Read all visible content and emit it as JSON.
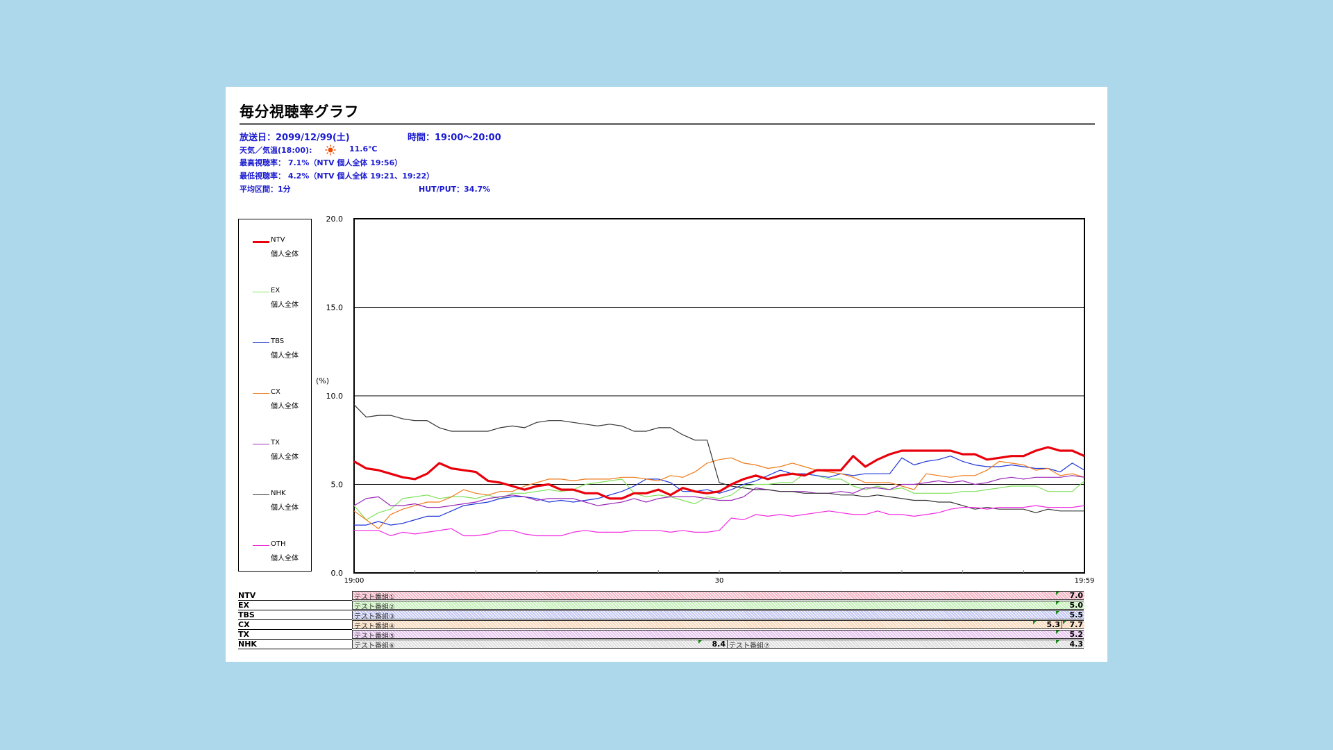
{
  "title": "毎分視聴率グラフ",
  "info": {
    "broadcast_date": "放送日：2099/12/99(土)",
    "time": "時間：19:00～20:00",
    "weather_label": "天気／気温(18:00):",
    "weather_icon": "sun-icon",
    "temperature": "11.6℃",
    "max_rating": "最高視聴率：  7.1%（NTV 個人全体 19:56）",
    "min_rating": "最低視聴率：  4.2%（NTV 個人全体 19:21、19:22）",
    "interval": "平均区間：1分",
    "hut_put": "HUT/PUT：34.7%"
  },
  "legend": [
    {
      "name": "NTV",
      "sub": "個人全体",
      "color": "#e8000b",
      "width": 3
    },
    {
      "name": "EX",
      "sub": "個人全体",
      "color": "#7fe05a",
      "width": 1
    },
    {
      "name": "TBS",
      "sub": "個人全体",
      "color": "#1f35d8",
      "width": 1
    },
    {
      "name": "CX",
      "sub": "個人全体",
      "color": "#f07a1a",
      "width": 1
    },
    {
      "name": "TX",
      "sub": "個人全体",
      "color": "#9a28b8",
      "width": 1
    },
    {
      "name": "NHK",
      "sub": "個人全体",
      "color": "#333333",
      "width": 1
    },
    {
      "name": "OTH",
      "sub": "個人全体",
      "color": "#f02ae0",
      "width": 1
    }
  ],
  "chart_data": {
    "type": "line",
    "ylabel": "(%)",
    "ylim": [
      0,
      20
    ],
    "yticks": [
      "0.0",
      "5.0",
      "10.0",
      "15.0",
      "20.0"
    ],
    "xticks": [
      "19:00",
      "30",
      "19:59"
    ],
    "x_minutes": [
      0,
      59
    ],
    "grid": true,
    "series": [
      {
        "name": "NTV",
        "values": [
          6.3,
          5.9,
          5.8,
          5.6,
          5.4,
          5.3,
          5.6,
          6.2,
          5.9,
          5.8,
          5.7,
          5.2,
          5.1,
          4.9,
          4.7,
          4.9,
          5.0,
          4.7,
          4.7,
          4.5,
          4.5,
          4.2,
          4.2,
          4.5,
          4.5,
          4.7,
          4.4,
          4.8,
          4.6,
          4.5,
          4.6,
          5.0,
          5.3,
          5.5,
          5.3,
          5.5,
          5.6,
          5.5,
          5.8,
          5.8,
          5.8,
          6.6,
          6.0,
          6.4,
          6.7,
          6.9,
          6.9,
          6.9,
          6.9,
          6.9,
          6.7,
          6.7,
          6.4,
          6.5,
          6.6,
          6.6,
          6.9,
          7.1,
          6.9,
          6.9,
          6.6
        ]
      },
      {
        "name": "EX",
        "values": [
          3.8,
          3.0,
          3.4,
          3.6,
          4.2,
          4.3,
          4.4,
          4.2,
          4.3,
          4.3,
          4.2,
          4.4,
          4.2,
          4.5,
          4.5,
          4.6,
          4.7,
          4.6,
          4.7,
          5.0,
          5.1,
          5.2,
          5.3,
          4.5,
          4.3,
          4.4,
          4.3,
          4.1,
          3.9,
          4.3,
          4.2,
          4.4,
          4.9,
          5.0,
          5.0,
          5.1,
          5.1,
          5.6,
          5.5,
          5.3,
          5.3,
          4.9,
          4.7,
          4.9,
          4.7,
          4.8,
          4.5,
          4.5,
          4.5,
          4.5,
          4.6,
          4.6,
          4.7,
          4.8,
          4.9,
          4.9,
          4.9,
          4.6,
          4.6,
          4.6,
          5.2
        ]
      },
      {
        "name": "TBS",
        "values": [
          2.7,
          2.7,
          2.9,
          2.7,
          2.8,
          3.0,
          3.2,
          3.2,
          3.5,
          3.8,
          3.9,
          4.0,
          4.2,
          4.3,
          4.3,
          4.2,
          4.0,
          4.1,
          4.0,
          4.1,
          4.2,
          4.4,
          4.6,
          4.9,
          5.3,
          5.3,
          5.1,
          4.6,
          4.6,
          4.7,
          4.5,
          4.7,
          5.0,
          5.2,
          5.5,
          5.8,
          5.6,
          5.6,
          5.5,
          5.4,
          5.6,
          5.5,
          5.6,
          5.6,
          5.6,
          6.5,
          6.1,
          6.3,
          6.4,
          6.6,
          6.3,
          6.1,
          6.0,
          6.0,
          6.1,
          6.0,
          5.9,
          5.9,
          5.7,
          6.2,
          5.8
        ]
      },
      {
        "name": "CX",
        "values": [
          3.5,
          3.0,
          2.5,
          3.3,
          3.6,
          3.8,
          4.0,
          4.0,
          4.3,
          4.7,
          4.5,
          4.4,
          4.6,
          4.6,
          4.9,
          5.1,
          5.3,
          5.3,
          5.2,
          5.3,
          5.3,
          5.3,
          5.4,
          5.4,
          5.3,
          5.2,
          5.5,
          5.4,
          5.7,
          6.2,
          6.4,
          6.5,
          6.2,
          6.1,
          5.9,
          6.0,
          6.2,
          6.0,
          5.8,
          5.7,
          5.6,
          5.4,
          5.1,
          5.1,
          5.1,
          4.9,
          4.7,
          5.6,
          5.5,
          5.4,
          5.5,
          5.5,
          5.8,
          6.3,
          6.2,
          6.1,
          5.8,
          5.9,
          5.5,
          5.6,
          5.4
        ]
      },
      {
        "name": "TX",
        "values": [
          3.8,
          4.2,
          4.3,
          3.8,
          3.8,
          3.9,
          3.7,
          3.7,
          3.8,
          3.9,
          4.0,
          4.2,
          4.3,
          4.4,
          4.3,
          4.1,
          4.2,
          4.2,
          4.2,
          4.0,
          3.8,
          3.9,
          4.0,
          4.2,
          4.0,
          4.2,
          4.3,
          4.3,
          4.3,
          4.2,
          4.1,
          4.1,
          4.3,
          4.8,
          4.7,
          4.6,
          4.6,
          4.6,
          4.5,
          4.5,
          4.6,
          4.5,
          4.8,
          4.8,
          4.7,
          5.0,
          5.0,
          5.1,
          5.2,
          5.1,
          5.2,
          5.0,
          5.1,
          5.3,
          5.4,
          5.3,
          5.4,
          5.4,
          5.4,
          5.5,
          5.4
        ]
      },
      {
        "name": "NHK",
        "values": [
          9.5,
          8.8,
          8.9,
          8.9,
          8.7,
          8.6,
          8.6,
          8.2,
          8.0,
          8.0,
          8.0,
          8.0,
          8.2,
          8.3,
          8.2,
          8.5,
          8.6,
          8.6,
          8.5,
          8.4,
          8.3,
          8.4,
          8.3,
          8.0,
          8.0,
          8.2,
          8.2,
          7.8,
          7.5,
          7.5,
          5.1,
          4.9,
          4.8,
          4.7,
          4.7,
          4.6,
          4.6,
          4.5,
          4.5,
          4.5,
          4.4,
          4.4,
          4.3,
          4.4,
          4.3,
          4.2,
          4.1,
          4.1,
          4.0,
          4.0,
          3.8,
          3.6,
          3.7,
          3.6,
          3.6,
          3.6,
          3.4,
          3.6,
          3.5,
          3.5,
          3.5
        ]
      },
      {
        "name": "OTH",
        "values": [
          2.4,
          2.4,
          2.4,
          2.1,
          2.3,
          2.2,
          2.3,
          2.4,
          2.5,
          2.1,
          2.1,
          2.2,
          2.4,
          2.4,
          2.2,
          2.1,
          2.1,
          2.1,
          2.3,
          2.4,
          2.3,
          2.3,
          2.3,
          2.4,
          2.4,
          2.4,
          2.3,
          2.4,
          2.3,
          2.3,
          2.4,
          3.1,
          3.0,
          3.3,
          3.2,
          3.3,
          3.2,
          3.3,
          3.4,
          3.5,
          3.4,
          3.3,
          3.3,
          3.5,
          3.3,
          3.3,
          3.2,
          3.3,
          3.4,
          3.6,
          3.7,
          3.7,
          3.6,
          3.7,
          3.7,
          3.7,
          3.8,
          3.7,
          3.7,
          3.7,
          3.8
        ]
      }
    ]
  },
  "programs": [
    {
      "channel": "NTV",
      "pattern": "#f3b4c4",
      "segments": [
        {
          "label": "テスト番組①",
          "value": "7.0"
        }
      ]
    },
    {
      "channel": "EX",
      "pattern": "#c4f0b8",
      "segments": [
        {
          "label": "テスト番組②",
          "value": "5.0"
        }
      ]
    },
    {
      "channel": "TBS",
      "pattern": "#c4c8f3",
      "segments": [
        {
          "label": "テスト番組③",
          "value": "5.5"
        }
      ]
    },
    {
      "channel": "CX",
      "pattern": "#f8d7b8",
      "segments": [
        {
          "label": "テスト番組④",
          "value": "5.3"
        },
        {
          "label": "",
          "value": "7.7"
        }
      ]
    },
    {
      "channel": "TX",
      "pattern": "#e6c4ef",
      "segments": [
        {
          "label": "テスト番組⑤",
          "value": "5.2"
        }
      ]
    },
    {
      "channel": "NHK",
      "pattern": "#dddddd",
      "segments": [
        {
          "label": "テスト番組⑥",
          "value": "8.4"
        },
        {
          "label": "テスト番組⑦",
          "value": "4.3"
        }
      ]
    }
  ]
}
